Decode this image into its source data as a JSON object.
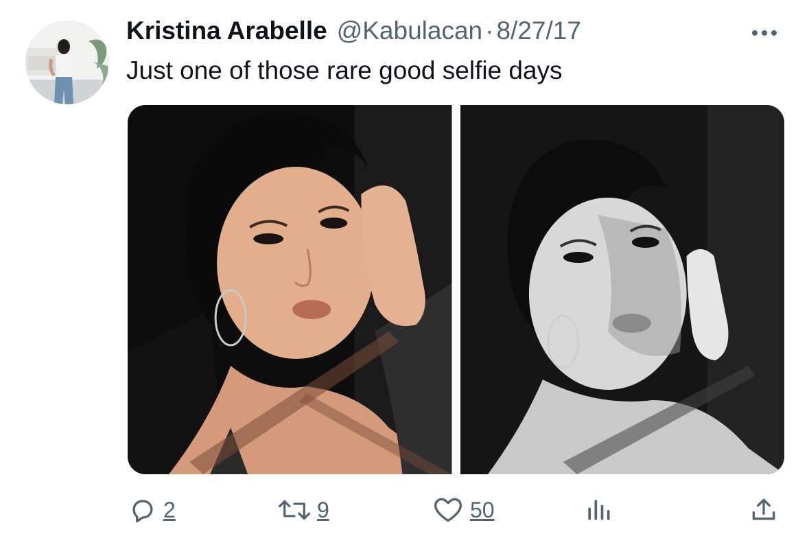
{
  "tweet": {
    "author_name": "Kristina Arabelle",
    "handle": "@Kabulacan",
    "separator": "·",
    "date": "8/27/17",
    "text": "Just one of those rare good selfie days"
  },
  "actions": {
    "replies": "2",
    "retweets": "9",
    "likes": "50"
  },
  "icons": [
    "more-icon",
    "reply-icon",
    "retweet-icon",
    "like-icon",
    "views-icon",
    "share-icon"
  ],
  "colors": {
    "text": "#0f1419",
    "secondary": "#536471"
  }
}
